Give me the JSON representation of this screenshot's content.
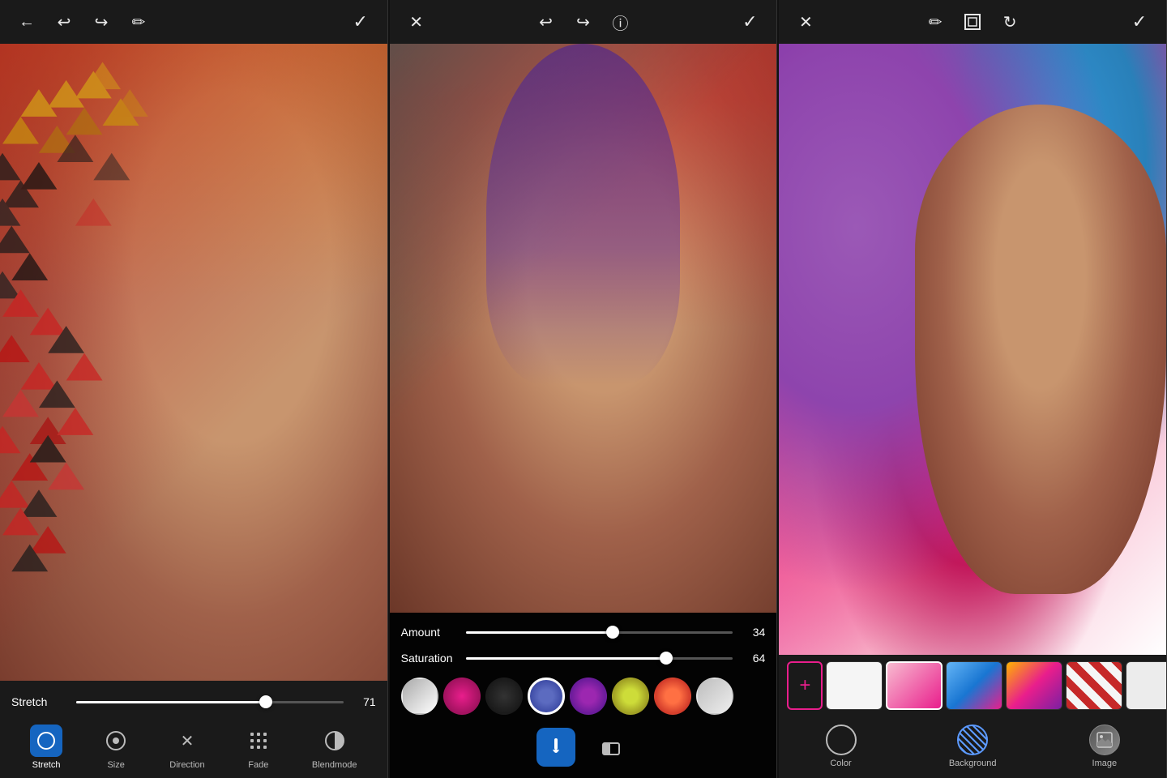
{
  "panels": [
    {
      "id": "panel1",
      "topbar": {
        "back_label": "←",
        "undo_label": "↩",
        "redo_label": "↪",
        "erase_label": "✏",
        "check_label": "✓"
      },
      "slider": {
        "label": "Stretch",
        "value": 71,
        "percent": 71
      },
      "tools": [
        {
          "id": "stretch",
          "label": "Stretch",
          "icon": "◎",
          "active": true
        },
        {
          "id": "size",
          "label": "Size",
          "icon": "◉",
          "active": false
        },
        {
          "id": "direction",
          "label": "Direction",
          "icon": "✕",
          "active": false
        },
        {
          "id": "fade",
          "label": "Fade",
          "icon": "⁚⁚",
          "active": false
        },
        {
          "id": "blendmode",
          "label": "Blendmode",
          "icon": "◑",
          "active": false
        }
      ]
    },
    {
      "id": "panel2",
      "topbar": {
        "close_label": "✕",
        "undo_label": "↩",
        "redo_label": "↪",
        "info_label": "ⓘ",
        "check_label": "✓"
      },
      "sliders": [
        {
          "label": "Amount",
          "value": 34,
          "percent": 55
        },
        {
          "label": "Saturation",
          "value": 64,
          "percent": 75
        }
      ],
      "swatches": [
        {
          "color": "#d0d0d0",
          "gradient": "linear-gradient(135deg, #aaa 0%, #fff 100%)",
          "selected": false
        },
        {
          "color": "#c2185b",
          "gradient": "radial-gradient(circle, #e91e8c 0%, #880e4f 100%)",
          "selected": false
        },
        {
          "color": "#212121",
          "gradient": "radial-gradient(circle, #333 0%, #111 100%)",
          "selected": false
        },
        {
          "color": "#3949ab",
          "gradient": "radial-gradient(circle, #5c6bc0 30%, #283593 100%)",
          "selected": true
        },
        {
          "color": "#7b1fa2",
          "gradient": "radial-gradient(circle, #9c27b0 30%, #4a148c 100%)",
          "selected": false
        },
        {
          "color": "#8d6e1d",
          "gradient": "radial-gradient(circle, #cddc39 30%, #827717 100%)",
          "selected": false
        },
        {
          "color": "#bf360c",
          "gradient": "radial-gradient(circle, #ff7043 30%, #b71c1c 100%)",
          "selected": false
        },
        {
          "color": "#e0e0e0",
          "gradient": "linear-gradient(135deg, #bdbdbd 0%, #eeeeee 100%)",
          "selected": false
        }
      ],
      "edit_tools": [
        {
          "id": "brush",
          "icon": "✏",
          "active": true
        },
        {
          "id": "eraser",
          "icon": "⬜",
          "active": false
        }
      ]
    },
    {
      "id": "panel3",
      "topbar": {
        "close_label": "✕",
        "erase_label": "✏",
        "ratio_label": "▣",
        "rotate_label": "↻",
        "check_label": "✓"
      },
      "thumbnails": [
        {
          "id": "white",
          "class": "bt-white",
          "selected": false
        },
        {
          "id": "pink",
          "class": "bt-pink",
          "selected": true
        },
        {
          "id": "blue",
          "class": "bt-blue",
          "selected": false
        },
        {
          "id": "colorful",
          "class": "bt-colorful",
          "selected": false
        },
        {
          "id": "red",
          "class": "bt-red",
          "selected": false
        },
        {
          "id": "white2",
          "class": "bt-white2",
          "selected": false
        },
        {
          "id": "lined",
          "class": "bt-lined",
          "selected": false
        }
      ],
      "tabs": [
        {
          "id": "color",
          "label": "Color",
          "type": "circle"
        },
        {
          "id": "background",
          "label": "Background",
          "type": "hatch"
        },
        {
          "id": "image",
          "label": "Image",
          "type": "image"
        }
      ]
    }
  ]
}
